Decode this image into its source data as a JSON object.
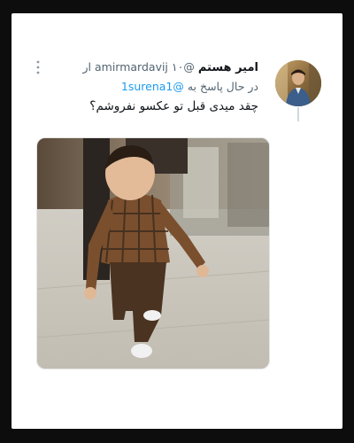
{
  "tweet": {
    "display_name": "امیر هستم",
    "handle": "@amirmardavij",
    "time": "۱۰ ار",
    "replying_label": "در حال پاسخ به",
    "replying_to": "@1surena1",
    "text": "چقد میدی قبل تو عکسو نفروشم؟"
  },
  "icons": {
    "more": "more-vertical-icon",
    "avatar": "user-avatar"
  },
  "colors": {
    "mention": "#1d9bf0",
    "secondary_text": "#536471",
    "primary_text": "#0f1419",
    "background": "#0d0d0d"
  }
}
